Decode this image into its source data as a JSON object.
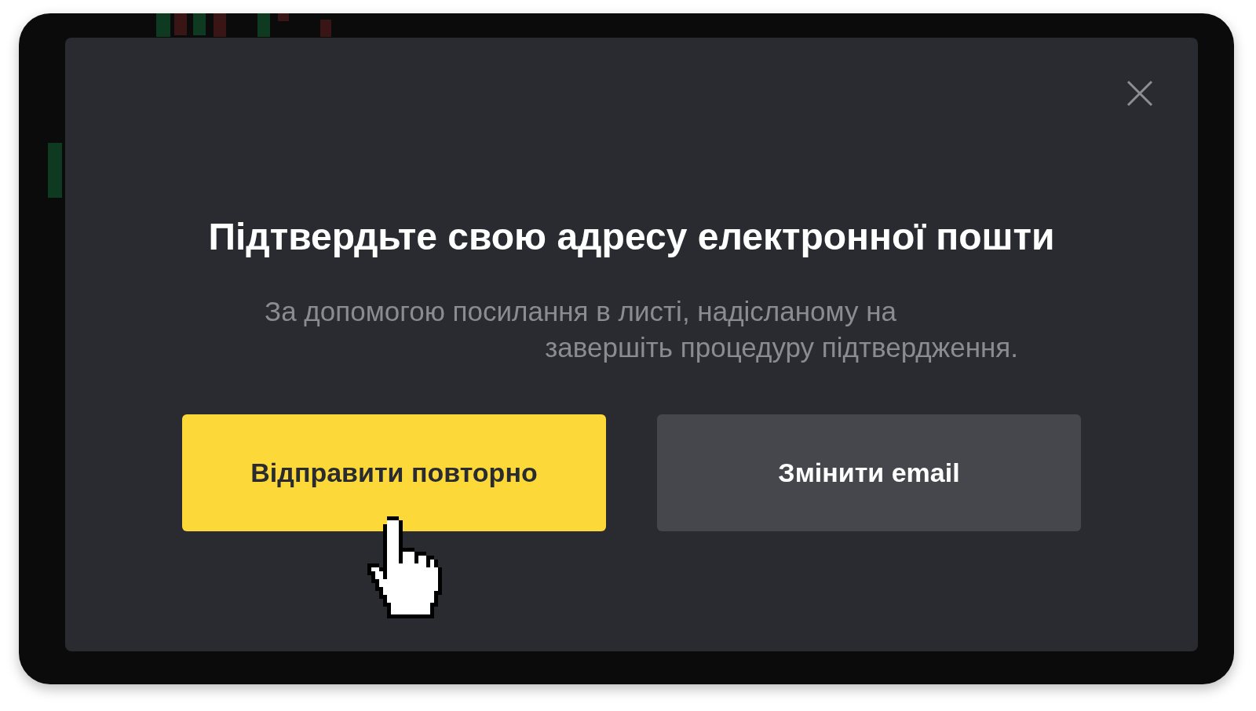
{
  "dialog": {
    "title": "Підтвердьте свою адресу електронної пошти",
    "description": [
      "За допомогою посилання в листі, надісланому на",
      "завершіть процедуру підтвердження."
    ],
    "buttons": [
      {
        "label": "Відправити повторно",
        "kind": "primary"
      },
      {
        "label": "Змінити email",
        "kind": "secondary"
      }
    ]
  }
}
